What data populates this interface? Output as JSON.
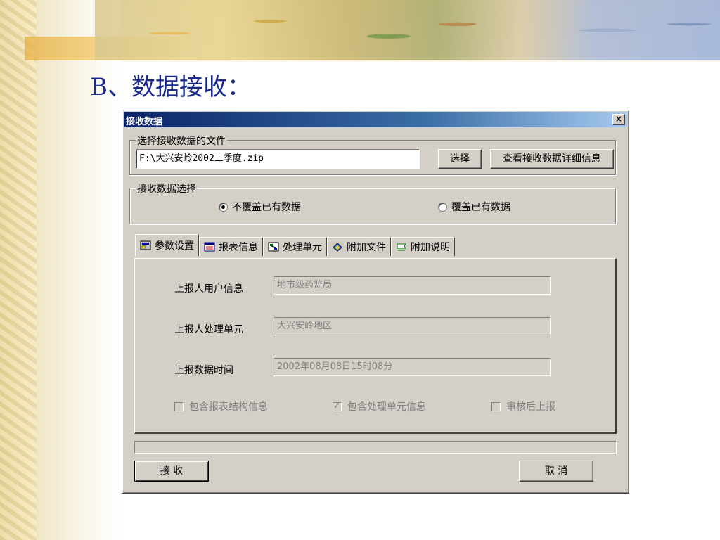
{
  "slide": {
    "title": "B、数据接收："
  },
  "dialog": {
    "title": "接收数据",
    "close_label": "×",
    "file_group": {
      "legend": "选择接收数据的文件",
      "path_value": "F:\\大兴安岭2002二季度.zip",
      "select_button": "选择",
      "details_button": "查看接收数据详细信息"
    },
    "receive_group": {
      "legend": "接收数据选择",
      "options": [
        {
          "label": "不覆盖已有数据",
          "checked": true
        },
        {
          "label": "覆盖已有数据",
          "checked": false
        }
      ]
    },
    "tabs": [
      {
        "label": "参数设置",
        "icon": "settings-icon",
        "active": true
      },
      {
        "label": "报表信息",
        "icon": "report-icon",
        "active": false
      },
      {
        "label": "处理单元",
        "icon": "unit-icon",
        "active": false
      },
      {
        "label": "附加文件",
        "icon": "attachment-icon",
        "active": false
      },
      {
        "label": "附加说明",
        "icon": "note-icon",
        "active": false
      }
    ],
    "fields": [
      {
        "label": "上报人用户信息",
        "value": "地市级药监局"
      },
      {
        "label": "上报人处理单元",
        "value": "大兴安岭地区"
      },
      {
        "label": "上报数据时间",
        "value": "2002年08月08日15时08分"
      }
    ],
    "checkboxes": [
      {
        "label": "包含报表结构信息",
        "checked": false
      },
      {
        "label": "包含处理单元信息",
        "checked": true
      },
      {
        "label": "审核后上报",
        "checked": false
      }
    ],
    "receive_button": "接 收",
    "cancel_button": "取 消"
  },
  "colors": {
    "dialog_bg": "#d4d0c8",
    "titlebar_start": "#0a246a",
    "titlebar_end": "#a6caf0",
    "slide_title": "#1a2a8a"
  }
}
